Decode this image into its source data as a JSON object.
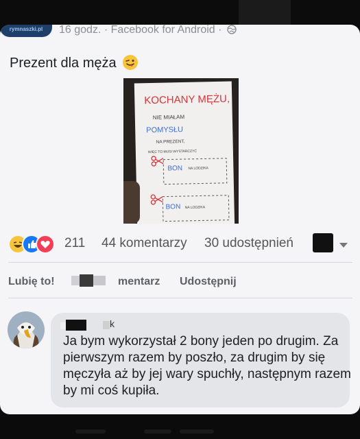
{
  "post": {
    "meta": "16 godz. · Facebook for Android ·",
    "text": "Prezent dla męża",
    "page_avatar_text": "rymnaszki.pl"
  },
  "note": {
    "line1": "KOCHANY MĘŻU,",
    "line2": "NIE MIAŁAM",
    "line3": "POMYSŁU",
    "line4": "NA PREZENT,",
    "line5": "WIĘC TO MUSI WYSTARCZYĆ",
    "coupon1_big": "BON",
    "coupon1_small": "NA LODZIKA",
    "coupon2_big": "BON",
    "coupon2_small": "NA LODZIKA"
  },
  "stats": {
    "reactions_count": "211",
    "comments": "44 komentarzy",
    "shares": "30 udostępnień"
  },
  "actions": {
    "like": "Lubię to!",
    "comment": "mentarz",
    "share": "Udostępnij"
  },
  "comment": {
    "author_visible": "k",
    "text": "Ja bym wykorzystał 2 bony jeden po drugim. Za pierwszym razem by poszło, za drugim by się męczyła aż by jej wary spuchły, następnym razem by mi coś kupiła."
  },
  "colors": {
    "like_blue": "#1877f2",
    "love_red": "#f33e58",
    "haha_yellow": "#f7c53c",
    "note_red": "#d6353a",
    "note_blue": "#3a6fd8"
  }
}
